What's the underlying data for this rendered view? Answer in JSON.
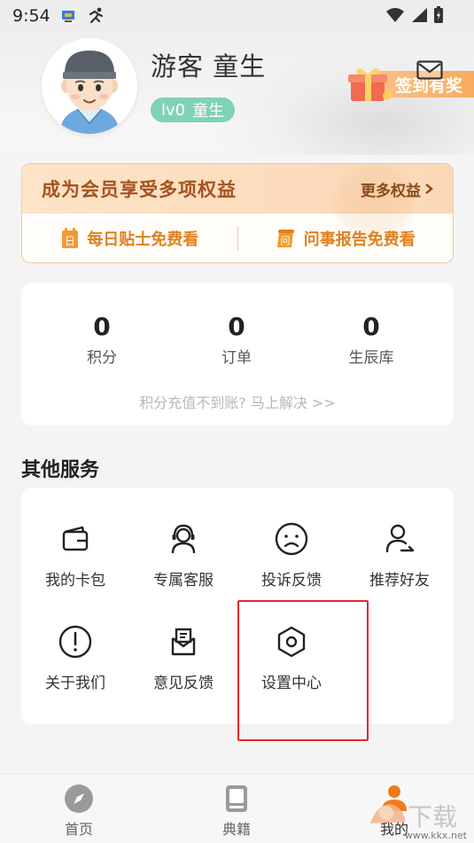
{
  "status_bar": {
    "time": "9:54"
  },
  "profile": {
    "username": "游客  童生",
    "level": "lv0",
    "level_title": "童生",
    "checkin_label": "签到有奖"
  },
  "vip": {
    "title": "成为会员享受多项权益",
    "more": "更多权益",
    "benefit_1": "每日贴士免费看",
    "benefit_1_icon_char": "日",
    "benefit_2": "问事报告免费看",
    "benefit_2_icon_char": "问"
  },
  "stats": {
    "items": [
      {
        "value": "0",
        "label": "积分"
      },
      {
        "value": "0",
        "label": "订单"
      },
      {
        "value": "0",
        "label": "生辰库"
      }
    ],
    "hint": "积分充值不到账? 马上解决 >>"
  },
  "services": {
    "title": "其他服务",
    "items": [
      {
        "label": "我的卡包",
        "icon": "wallet-icon"
      },
      {
        "label": "专属客服",
        "icon": "customer-service-icon"
      },
      {
        "label": "投诉反馈",
        "icon": "sad-face-icon"
      },
      {
        "label": "推荐好友",
        "icon": "user-share-icon"
      },
      {
        "label": "关于我们",
        "icon": "info-exclaim-icon"
      },
      {
        "label": "意见反馈",
        "icon": "feedback-mail-icon"
      },
      {
        "label": "设置中心",
        "icon": "settings-hex-icon"
      }
    ]
  },
  "nav": {
    "items": [
      {
        "label": "首页",
        "icon": "compass-icon"
      },
      {
        "label": "典籍",
        "icon": "book-icon"
      },
      {
        "label": "我的",
        "icon": "person-icon"
      }
    ]
  },
  "watermark": {
    "text": "下载",
    "url": "www.kkx.net"
  },
  "colors": {
    "accent_orange": "#f28a2a",
    "level_green": "#7fd2b5",
    "vip_brown": "#a5531f",
    "highlight_red": "#e8262a"
  }
}
